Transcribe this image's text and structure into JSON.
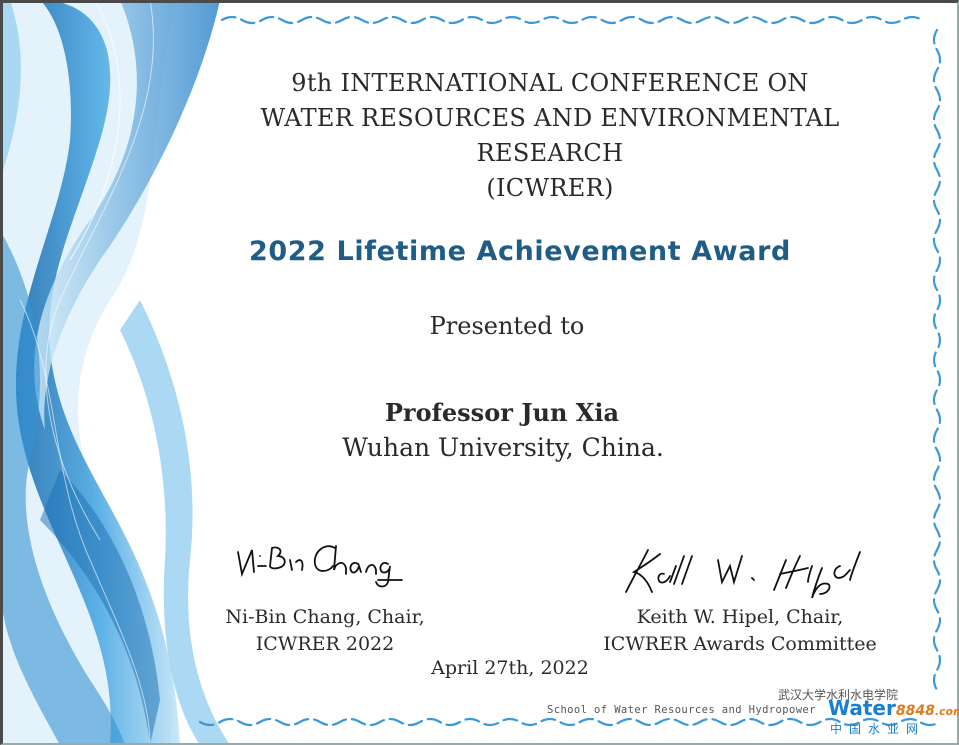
{
  "conference": {
    "lines": [
      "9th INTERNATIONAL CONFERENCE ON",
      "WATER RESOURCES AND ENVIRONMENTAL",
      "RESEARCH",
      "(ICWRER)"
    ]
  },
  "award": {
    "title": "2022 Lifetime Achievement Award"
  },
  "presented": {
    "text": "Presented to"
  },
  "recipient": {
    "name": "Professor Jun Xia",
    "affiliation": "Wuhan University, China."
  },
  "signatories": [
    {
      "signature": "Ni-Bin Chang",
      "name_line": "Ni-Bin Chang, Chair,",
      "role_line": "ICWRER 2022"
    },
    {
      "signature": "Keith W. Hipel",
      "name_line": "Keith W. Hipel, Chair,",
      "role_line": "ICWRER Awards Committee"
    }
  ],
  "date": "April 27th, 2022",
  "watermark": {
    "cn_school": "武汉大学水利水电学院",
    "school": "School of Water Resources and Hydropower",
    "logo_word": "Water",
    "logo_num": "8848",
    "logo_suffix": ".com",
    "cn_site": "中国水业网"
  },
  "colors": {
    "award_title": "#1f5c86",
    "wave": "#2b8fd4"
  }
}
